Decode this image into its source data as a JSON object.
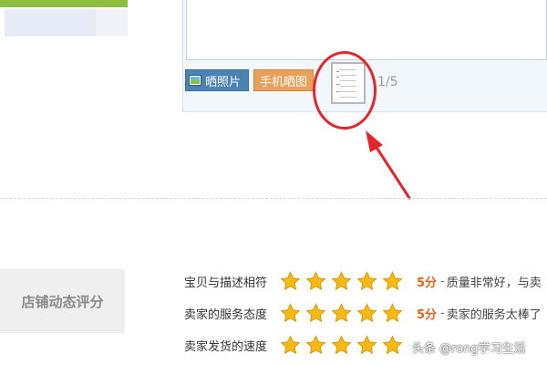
{
  "review": {
    "photo_button_label": "晒照片",
    "phone_button_label": "手机晒图",
    "photo_count": "1/5"
  },
  "dsr": {
    "section_label": "店铺动态评分",
    "rows": [
      {
        "name": "宝贝与描述相符",
        "stars": 5,
        "score": "5分",
        "dash": "-",
        "desc": "质量非常好，与卖"
      },
      {
        "name": "卖家的服务态度",
        "stars": 5,
        "score": "5分",
        "dash": "-",
        "desc": "卖家的服务太棒了"
      },
      {
        "name": "卖家发货的速度",
        "stars": 5,
        "score": "",
        "dash": "",
        "desc": ""
      }
    ],
    "star_color": "#f5b916"
  },
  "watermark": "头条 @rong学习生活"
}
